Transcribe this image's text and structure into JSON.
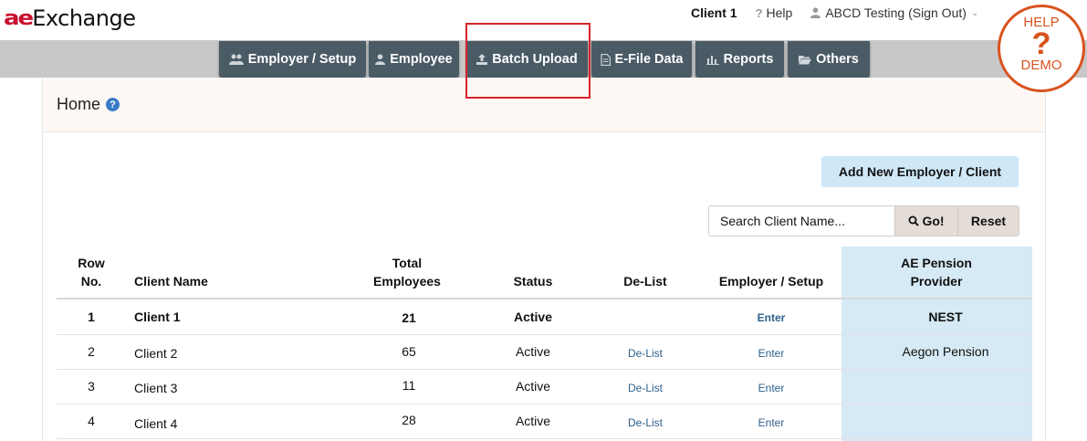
{
  "app": {
    "logo_prefix": "ae",
    "logo_rest": "Exchange"
  },
  "header": {
    "client_name": "Client 1",
    "help_label": "Help",
    "user_label": "ABCD Testing (Sign Out)"
  },
  "help_demo": {
    "top_label": "HELP",
    "mark": "?",
    "bottom_label": "DEMO"
  },
  "nav": {
    "tabs": [
      {
        "label": "Employer / Setup",
        "icon": "users-icon"
      },
      {
        "label": "Employee",
        "icon": "user-icon"
      },
      {
        "label": "Batch Upload",
        "icon": "upload-icon"
      },
      {
        "label": "E-File Data",
        "icon": "file-icon"
      },
      {
        "label": "Reports",
        "icon": "bar-chart-icon"
      },
      {
        "label": "Others",
        "icon": "folder-open-icon"
      }
    ],
    "highlighted_tab": "Batch Upload",
    "highlight_color": "#d8232a"
  },
  "page": {
    "title": "Home",
    "help_mark": "?"
  },
  "actions": {
    "add_label": "Add New Employer / Client",
    "search_placeholder": "Search Client Name...",
    "go_label": "Go!",
    "reset_label": "Reset"
  },
  "table": {
    "headers": {
      "row_no_1": "Row",
      "row_no_2": "No.",
      "client_name": "Client Name",
      "total_1": "Total",
      "total_2": "Employees",
      "status": "Status",
      "delist": "De-List",
      "employer_setup": "Employer / Setup",
      "pension_1": "AE Pension",
      "pension_2": "Provider"
    },
    "rows": [
      {
        "row": "1",
        "client": "Client 1",
        "employees": "21",
        "status": "Active",
        "delist": "",
        "enter": "Enter",
        "provider": "NEST"
      },
      {
        "row": "2",
        "client": "Client  2",
        "employees": "65",
        "status": "Active",
        "delist": "De-List",
        "enter": "Enter",
        "provider": "Aegon Pension"
      },
      {
        "row": "3",
        "client": "Client  3",
        "employees": "11",
        "status": "Active",
        "delist": "De-List",
        "enter": "Enter",
        "provider": ""
      },
      {
        "row": "4",
        "client": "Client  4",
        "employees": "28",
        "status": "Active",
        "delist": "De-List",
        "enter": "Enter",
        "provider": ""
      }
    ]
  },
  "colors": {
    "nav_tab": "#4a5b66",
    "nav_bar": "#c8c8c8",
    "accent_orange": "#d9531e",
    "add_button": "#cfe8f7",
    "pension_column": "#d6eaf5"
  }
}
